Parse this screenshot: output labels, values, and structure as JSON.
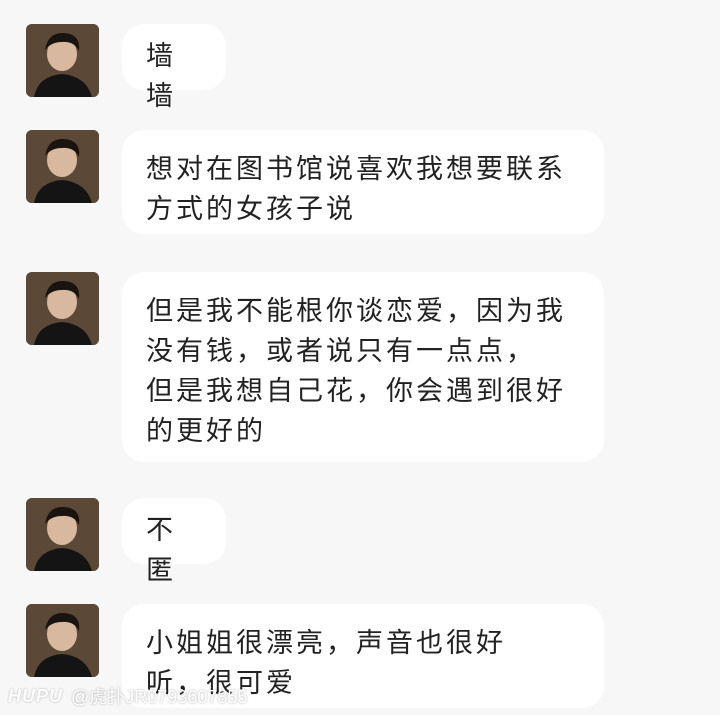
{
  "messages": [
    {
      "text": "墙墙",
      "avatar_icon": "person-avatar-icon"
    },
    {
      "text": "想对在图书馆说喜欢我想要联系\n方式的女孩子说",
      "avatar_icon": "person-avatar-icon"
    },
    {
      "text": "但是我不能根你谈恋爱，因为我\n没有钱，或者说只有一点点，\n但是我想自己花，你会遇到很好\n的更好的",
      "avatar_icon": "person-avatar-icon"
    },
    {
      "text": "不匿",
      "avatar_icon": "person-avatar-icon"
    },
    {
      "text": "小姐姐很漂亮，声音也很好\n听，很可爱",
      "avatar_icon": "person-avatar-icon"
    }
  ],
  "watermark": {
    "logo": "HUPU",
    "handle": "@虎扑JR0793607855"
  }
}
